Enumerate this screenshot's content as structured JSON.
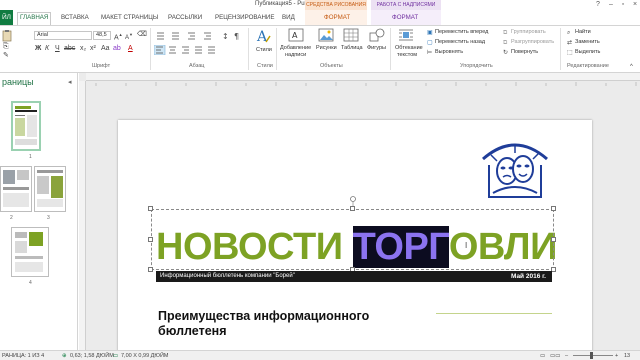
{
  "window": {
    "title": "Публикация5 - Publisher",
    "context_drawing": "СРЕДСТВА РИСОВАНИЯ",
    "context_text": "РАБОТА С НАДПИСЯМИ",
    "help": "?"
  },
  "tabs": {
    "file": "ЙЛ",
    "home": "ГЛАВНАЯ",
    "insert": "ВСТАВКА",
    "layout": "МАКЕТ СТРАНИЦЫ",
    "mailings": "РАССЫЛКИ",
    "review": "РЕЦЕНЗИРОВАНИЕ",
    "view": "ВИД",
    "format1": "ФОРМАТ",
    "format2": "ФОРМАТ"
  },
  "ribbon": {
    "font_name": "Arial",
    "font_size": "48,5",
    "groups": {
      "font": "Шрифт",
      "paragraph": "Абзац",
      "styles": "Стили",
      "objects": "Объекты",
      "arrange": "Упорядочить",
      "editing": "Редактирование"
    },
    "buttons": {
      "styles": "Стили",
      "add_label_1": "Добавление",
      "add_label_2": "надписи",
      "pictures": "Рисунки",
      "table": "Таблица",
      "shapes": "Фигуры",
      "wrap_1": "Обтекание",
      "wrap_2": "текстом",
      "bring_forward": "Переместить вперед",
      "send_backward": "Переместить назад",
      "align": "Выровнять",
      "group": "Группировать",
      "ungroup": "Разгруппировать",
      "rotate": "Повернуть",
      "find": "Найти",
      "replace": "Заменить",
      "select": "Выделить"
    }
  },
  "pages_pane": {
    "header": "раницы",
    "pages": [
      "1",
      "2",
      "3",
      "4"
    ]
  },
  "document": {
    "headline_part1": "НОВОСТИ ",
    "headline_selected": "ТОРГ",
    "headline_part2": "ОВЛИ",
    "banner_left": "Информационный бюллетень компании \"Борей\"",
    "banner_right": "Май 2016 г.",
    "article_title": "Преимущества информационного бюллетеня"
  },
  "status": {
    "page": "РАНИЦА: 1 ИЗ 4",
    "position": "0,63; 1,58 ДЮЙМ",
    "size": "7,00 X 0,99 ДЮЙМ",
    "zoom": "13"
  },
  "colors": {
    "accent": "#217346",
    "headline_green": "#7da224",
    "selection_bg": "#0c0c20",
    "selection_text": "#8b73f0"
  }
}
